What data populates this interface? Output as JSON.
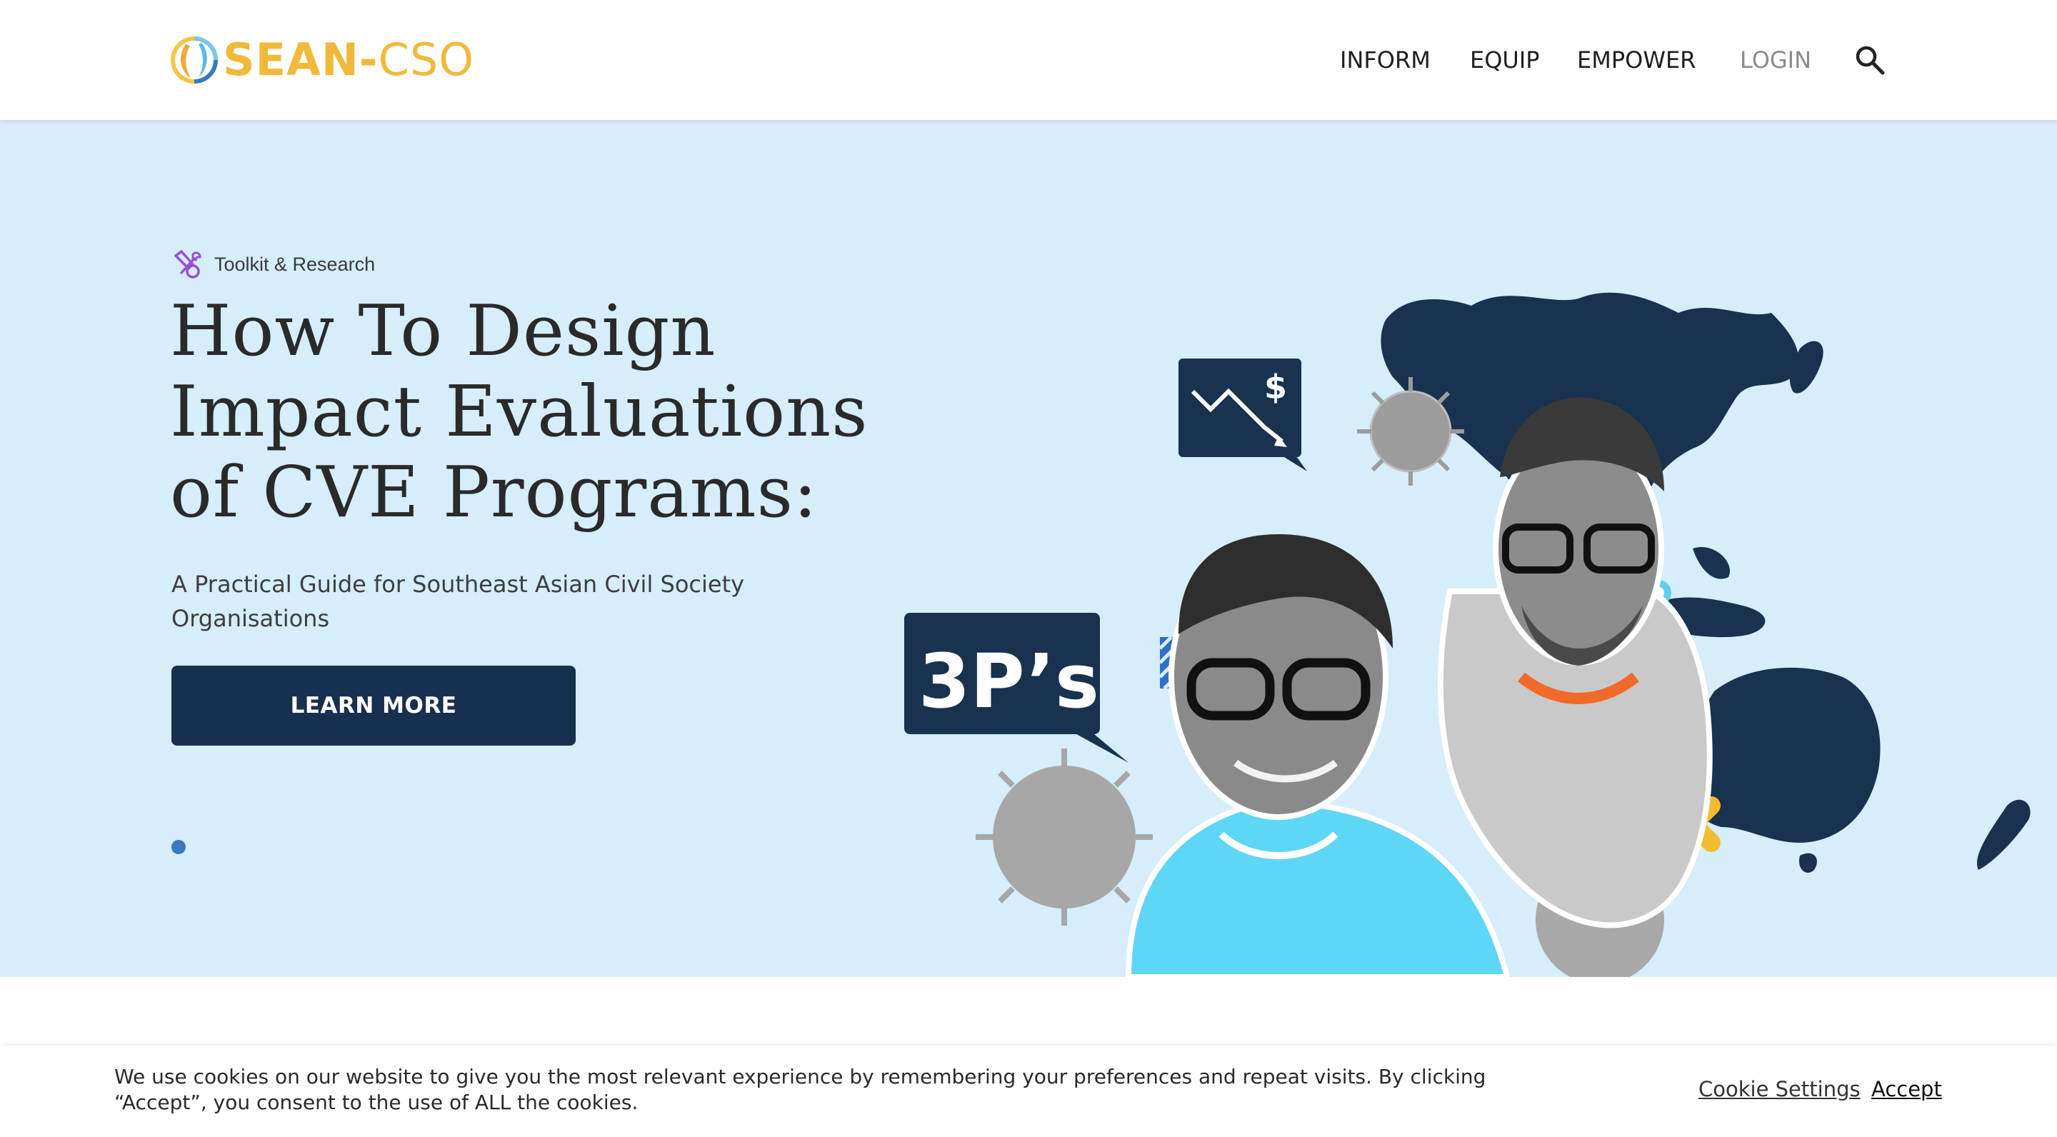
{
  "brand": {
    "name_part1": "SEAN",
    "separator": "-",
    "name_part2": "CSO",
    "logo_icon": "circular-logo-mark"
  },
  "nav": {
    "items": [
      "INFORM",
      "EQUIP",
      "EMPOWER"
    ],
    "login": "LOGIN",
    "search_icon": "search-icon"
  },
  "hero": {
    "category_icon": "tools-icon",
    "category": "Toolkit & Research",
    "title": "How To Design Impact Evaluations of CVE Programs:",
    "subtitle": "A Practical Guide for Southeast Asian Civil Society Organisations",
    "cta_label": "LEARN MORE",
    "art": {
      "badge_text": "3P’s",
      "chart_badge_symbol": "$"
    }
  },
  "cookie": {
    "text": "We use cookies on our website to give you the most relevant experience by remembering your preferences and repeat visits. By clicking “Accept”, you consent to the use of ALL the cookies.",
    "settings_label": "Cookie Settings",
    "accept_label": "Accept"
  },
  "colors": {
    "brand_yellow": "#f0b93a",
    "navy": "#17304f",
    "hero_bg": "#d6edfa",
    "accent_blue": "#3b78c0"
  }
}
